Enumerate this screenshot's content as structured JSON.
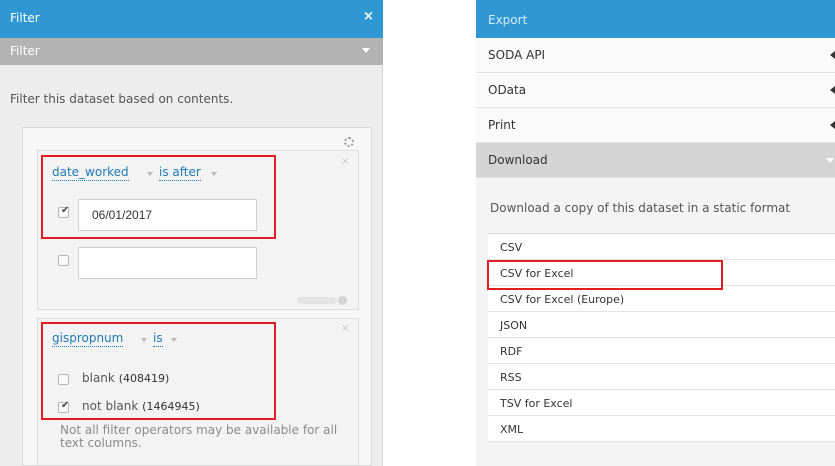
{
  "filter_panel": {
    "title": "Filter",
    "close_glyph": "×",
    "section_title": "Filter",
    "description": "Filter this dataset based on contents.",
    "conditions": [
      {
        "field": "date_worked",
        "operator": "is after",
        "inputs": [
          {
            "checked": true,
            "value": "06/01/2017"
          },
          {
            "checked": false,
            "value": ""
          }
        ]
      },
      {
        "field": "gispropnum",
        "operator": "is",
        "options": [
          {
            "label": "blank",
            "count": "(408419)",
            "checked": false
          },
          {
            "label": "not blank",
            "count": "(1464945)",
            "checked": true
          }
        ]
      }
    ],
    "note": "Not all filter operators may be available for all text columns.",
    "icons": [
      "gear-icon",
      "close-icon",
      "chevron-down-icon",
      "checkmark-icon"
    ]
  },
  "export_panel": {
    "title": "Export",
    "sections": [
      {
        "label": "SODA API"
      },
      {
        "label": "OData"
      },
      {
        "label": "Print"
      },
      {
        "label": "Download"
      }
    ],
    "download_description": "Download a copy of this dataset in a static format",
    "formats": [
      "CSV",
      "CSV for Excel",
      "CSV for Excel (Europe)",
      "JSON",
      "RDF",
      "RSS",
      "TSV for Excel",
      "XML"
    ]
  },
  "colors": {
    "title_bar": "#2f97d1",
    "section_bar": "#b3b3b3",
    "active_row": "#d4d4d4",
    "highlight": "#e31b23",
    "link": "#1f7bb6"
  }
}
